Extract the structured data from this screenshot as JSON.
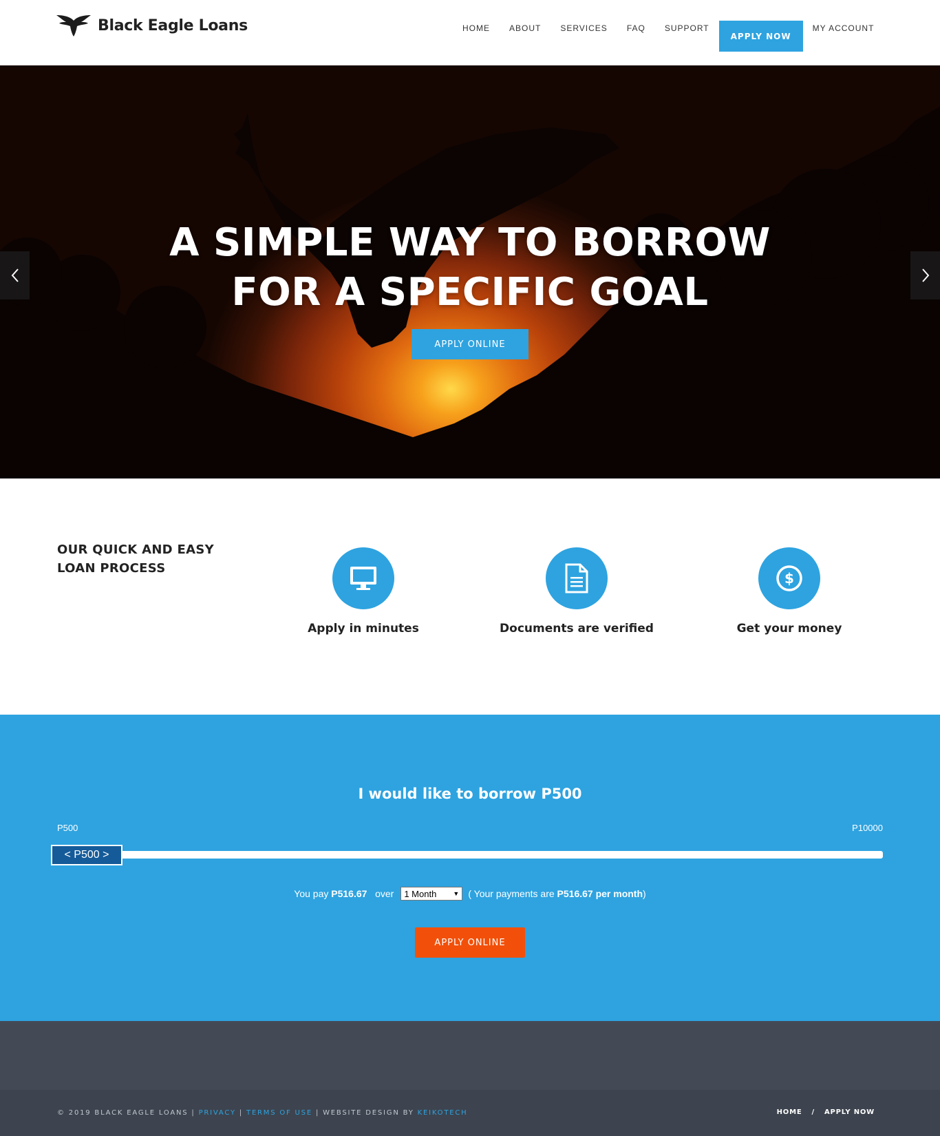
{
  "brand": {
    "name": "Black Eagle Loans",
    "accent": "#2ea3e0",
    "cta_color": "#f2500a"
  },
  "nav": {
    "items": [
      "HOME",
      "ABOUT",
      "SERVICES",
      "FAQ",
      "SUPPORT"
    ],
    "apply": "APPLY NOW",
    "account": "MY ACCOUNT"
  },
  "hero": {
    "title_line1": "A SIMPLE WAY TO BORROW",
    "title_line2": "FOR A SPECIFIC GOAL",
    "button": "APPLY ONLINE",
    "prev_icon": "chevron-left-icon",
    "next_icon": "chevron-right-icon"
  },
  "process": {
    "title": "OUR QUICK AND EASY LOAN PROCESS",
    "steps": [
      {
        "icon": "monitor-icon",
        "label": "Apply in minutes"
      },
      {
        "icon": "document-icon",
        "label": "Documents are verified"
      },
      {
        "icon": "dollar-icon",
        "label": "Get your money"
      }
    ]
  },
  "calculator": {
    "title": "I would like to borrow P500",
    "min": "P500",
    "max": "P10000",
    "handle": "< P500 >",
    "amount_level": 0,
    "you_pay_prefix": "You pay",
    "you_pay_amount": "P516.67",
    "over": "over",
    "term": "1 Month",
    "payments_prefix": "( Your payments are",
    "payments_amount": "P516.67 per month",
    "payments_suffix": ")",
    "button": "APPLY ONLINE"
  },
  "footer": {
    "copyright": "© 2019 BLACK EAGLE LOANS |",
    "privacy": "PRIVACY",
    "sep1": "|",
    "terms": "TERMS OF USE",
    "design_by": "| WEBSITE DESIGN BY",
    "designer": "KEIKOTECH",
    "nav_home": "HOME",
    "nav_sep": "/",
    "nav_apply": "APPLY NOW"
  }
}
